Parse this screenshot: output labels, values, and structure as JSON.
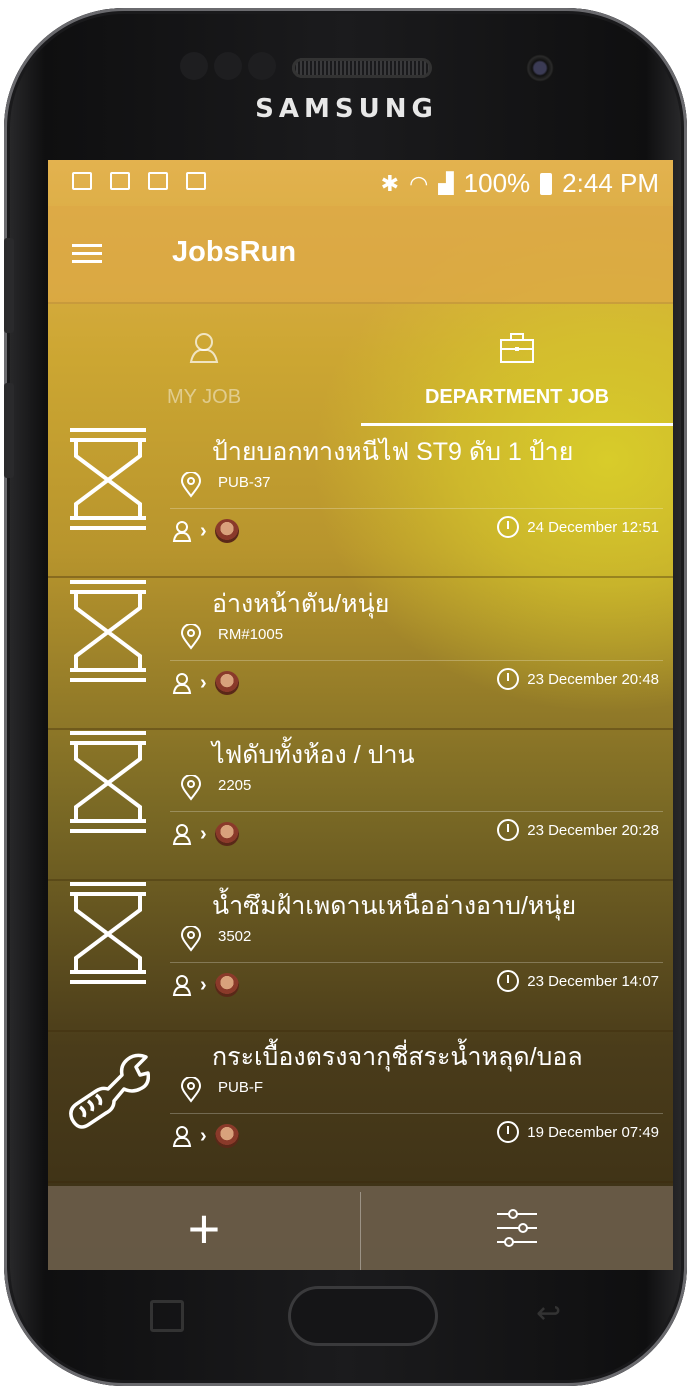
{
  "device": {
    "brand": "SAMSUNG"
  },
  "statusbar": {
    "battery": "100%",
    "time": "2:44 PM"
  },
  "appbar": {
    "title": "JobsRun"
  },
  "tabs": [
    {
      "label": "MY JOB",
      "active": false
    },
    {
      "label": "DEPARTMENT JOB",
      "active": true
    }
  ],
  "jobs": [
    {
      "title": "ป้ายบอกทางหนีไฟ ST9 ดับ 1 ป้าย",
      "location": "PUB-37",
      "date": "24 December  12:51",
      "icon": "hourglass-icon"
    },
    {
      "title": "อ่างหน้าตัน/หนุ่ย",
      "location": "RM#1005",
      "date": "23 December  20:48",
      "icon": "hourglass-icon"
    },
    {
      "title": "ไฟดับทั้งห้อง / ปาน",
      "location": "2205",
      "date": "23 December  20:28",
      "icon": "hourglass-icon"
    },
    {
      "title": "น้ำซึมฝ้าเพดานเหนืออ่างอาบ/หนุ่ย",
      "location": "3502",
      "date": "23 December  14:07",
      "icon": "hourglass-icon"
    },
    {
      "title": "กระเบื้องตรงจากุชี่สระน้ำหลุด/บอล",
      "location": "PUB-F",
      "date": "19 December  07:49",
      "icon": "wrench-hand-icon"
    }
  ],
  "bottombar": {
    "add_label": "+"
  },
  "colors": {
    "accent": "#e3b24f",
    "text": "#ffffff"
  }
}
